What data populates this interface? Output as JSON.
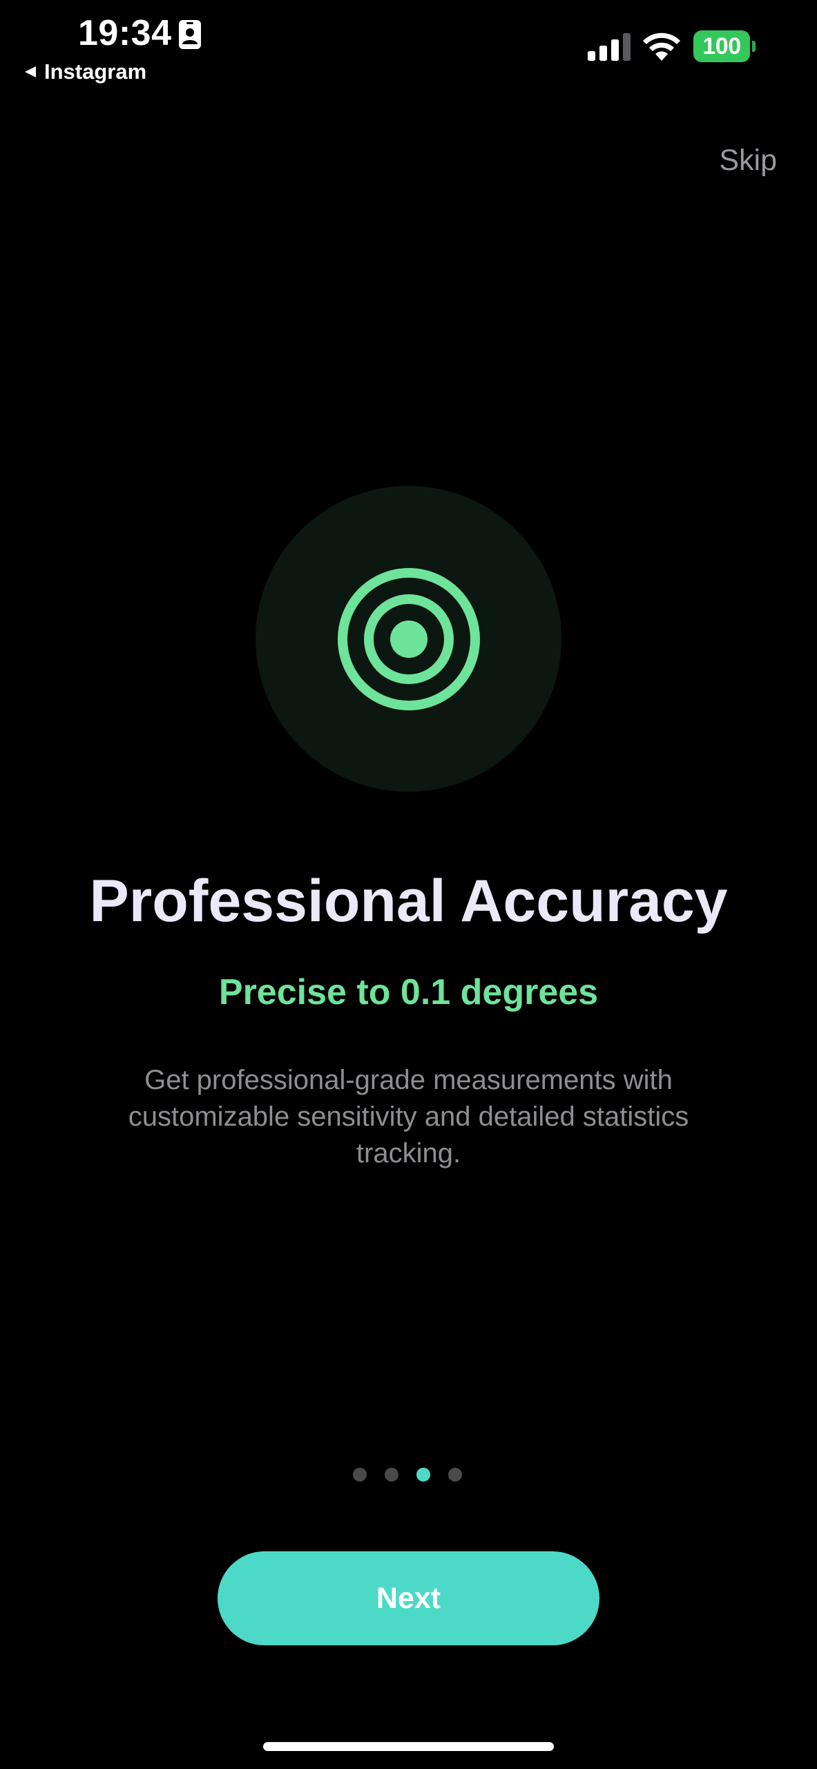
{
  "status_bar": {
    "time": "19:34",
    "back_app": "Instagram",
    "battery_level": "100"
  },
  "header": {
    "skip_label": "Skip"
  },
  "onboarding": {
    "title": "Professional Accuracy",
    "subtitle": "Precise to 0.1 degrees",
    "description": "Get professional-grade measurements with customizable sensitivity and detailed statistics tracking.",
    "icon": "target-icon",
    "page_count": 4,
    "current_page": 3
  },
  "actions": {
    "next_label": "Next"
  },
  "colors": {
    "accent": "#4dd9c8",
    "icon_green": "#6ee39a",
    "background": "#000000",
    "battery": "#34c759"
  }
}
